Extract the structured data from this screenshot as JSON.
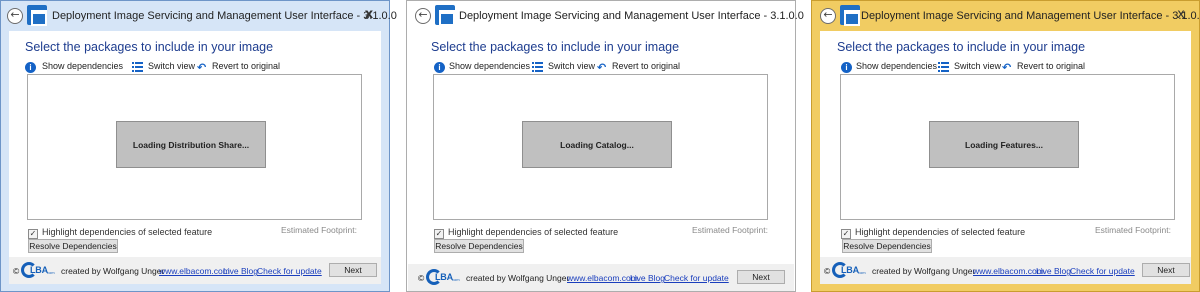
{
  "windows": [
    {
      "title": "Deployment Image Servicing and Management User Interface - 3.1.0.0",
      "close": "x",
      "loading_text": "Loading Distribution Share...",
      "frame_color": "#d6e5f7"
    },
    {
      "title": "Deployment Image Servicing and Management User Interface - 3.1.0.0",
      "close": "",
      "loading_text": "Loading Catalog...",
      "frame_color": "#ffffff"
    },
    {
      "title": "Deployment Image Servicing and Management User Interface - 3.1.0.0",
      "close": "x",
      "loading_text": "Loading Features...",
      "frame_color": "#f1cc62"
    }
  ],
  "heading": "Select the packages to include in your image",
  "toolbar": {
    "show_dependencies": "Show dependencies",
    "switch_view": "Switch view",
    "revert": "Revert to original"
  },
  "highlight_label": "Highlight dependencies of selected feature",
  "highlight_checked": "✓",
  "footprint_label": "Estimated Footprint:",
  "resolve_button": "Resolve Dependencies",
  "footer": {
    "copyright": "©",
    "logo_text": "LBA",
    "logo_sub": "com",
    "created_by": "created by Wolfgang Unger",
    "site_link": "www.elbacom.com",
    "blog_link": "Live Blog",
    "update_link": "Check for update",
    "next_button": "Next"
  },
  "icons": {
    "back": "back-arrow-icon",
    "app": "dism-app-icon",
    "info": "info-icon",
    "switch": "list-view-icon",
    "revert": "revert-arrow-icon"
  },
  "colors": {
    "heading": "#1e3d8f",
    "link": "#1a3ebd",
    "icon_blue": "#1462c6"
  }
}
